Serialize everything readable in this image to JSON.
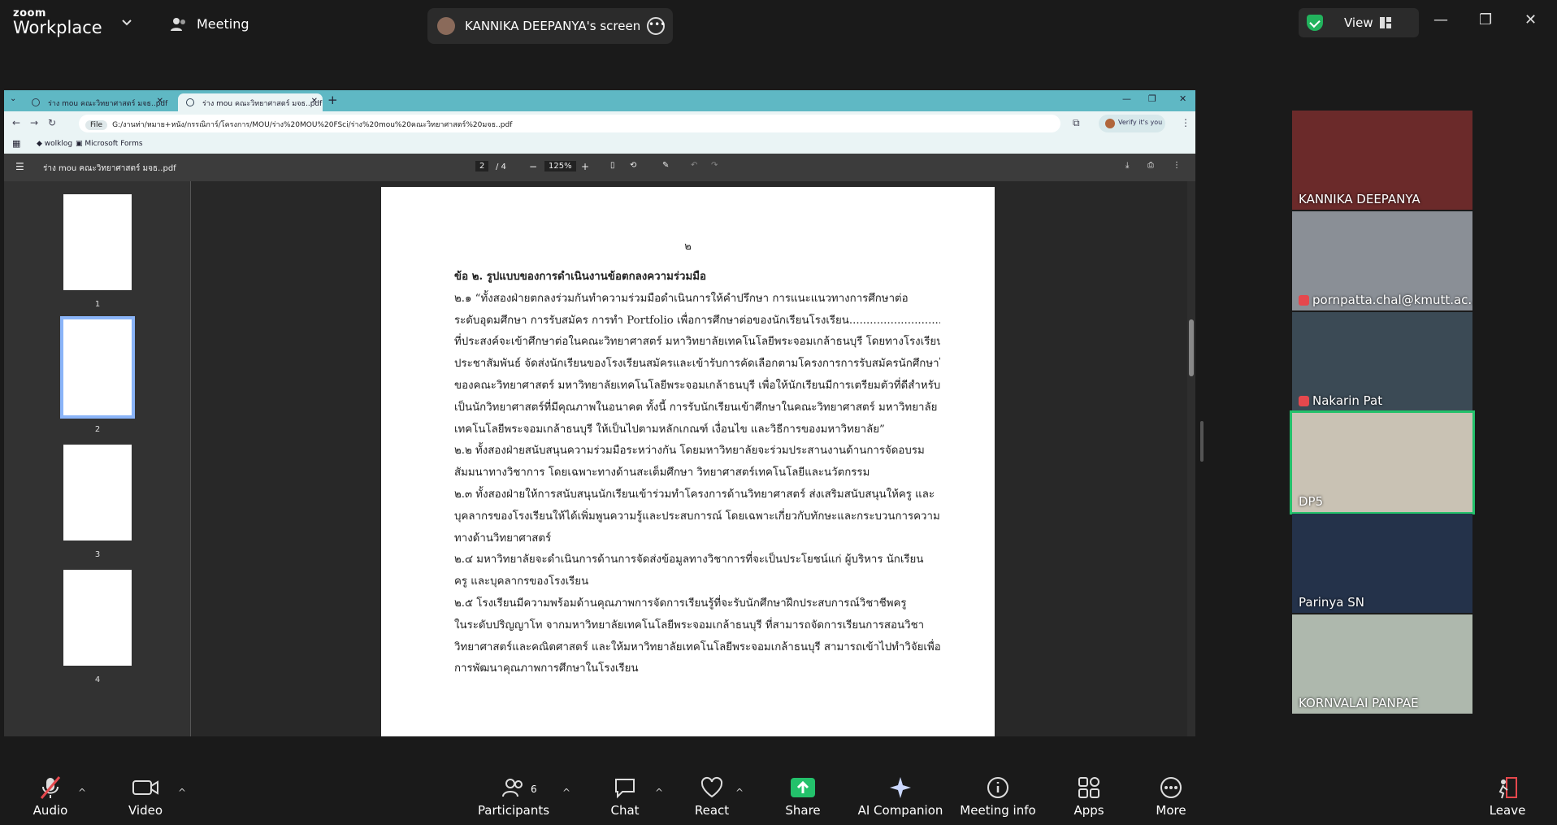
{
  "app": {
    "logo_top": "zoom",
    "logo_bottom": "Workplace",
    "meeting_label": "Meeting",
    "share_label": "KANNIKA DEEPANYA's screen",
    "view_label": "View"
  },
  "browser": {
    "tab1": "ร่าง mou คณะวิทยาศาสตร์ มจธ..pdf",
    "tab2": "ร่าง mou คณะวิทยาศาสตร์ มจธ..pdf",
    "file_badge": "File",
    "url": "G:/งานท่า/หมาย+หนัง/กรรณิการ์/โครงการ/MOU/ร่าง%20MOU%20FSci/ร่าง%20mou%20คณะวิทยาศาสตร์%20มจธ..pdf",
    "verify": "Verify it's you",
    "bookmark1": "wolklog",
    "bookmark2": "Microsoft Forms"
  },
  "pdf": {
    "title": "ร่าง mou คณะวิทยาศาสตร์ มจธ..pdf",
    "page_current": "2",
    "page_total": "/ 4",
    "zoom": "125%",
    "thumb_labels": [
      "1",
      "2",
      "3",
      "4"
    ],
    "page_number": "๒",
    "lines": [
      "ข้อ ๒. รูปแบบของการดำเนินงานข้อตกลงความร่วมมือ",
      "        ๒.๑ “ทั้งสองฝ่ายตกลงร่วมกันทำความร่วมมือดำเนินการให้คำปรึกษา การแนะแนวทางการศึกษาต่อ",
      "ระดับอุดมศึกษา การรับสมัคร การทำ Portfolio เพื่อการศึกษาต่อของนักเรียนโรงเรียน......................................",
      "ที่ประสงค์จะเข้าศึกษาต่อในคณะวิทยาศาสตร์ มหาวิทยาลัยเทคโนโลยีพระจอมเกล้าธนบุรี โดยทางโรงเรียนจะ",
      "ประชาสัมพันธ์ จัดส่งนักเรียนของโรงเรียนสมัครและเข้ารับการคัดเลือกตามโครงการการรับสมัครนักศึกษาใหม่",
      "ของคณะวิทยาศาสตร์ มหาวิทยาลัยเทคโนโลยีพระจอมเกล้าธนบุรี เพื่อให้นักเรียนมีการเตรียมตัวที่ดีสำหรับการ",
      "เป็นนักวิทยาศาสตร์ที่มีคุณภาพในอนาคต ทั้งนี้ การรับนักเรียนเข้าศึกษาในคณะวิทยาศาสตร์ มหาวิทยาลัย",
      "เทคโนโลยีพระจอมเกล้าธนบุรี ให้เป็นไปตามหลักเกณฑ์ เงื่อนไข และวิธีการของมหาวิทยาลัย”",
      "        ๒.๒ ทั้งสองฝ่ายสนับสนุนความร่วมมือระหว่างกัน โดยมหาวิทยาลัยจะร่วมประสานงานด้านการจัดอบรม",
      "สัมมนาทางวิชาการ โดยเฉพาะทางด้านสะเต็มศึกษา วิทยาศาสตร์เทคโนโลยีและนวัตกรรม",
      "        ๒.๓ ทั้งสองฝ่ายให้การสนับสนุนนักเรียนเข้าร่วมทำโครงการด้านวิทยาศาสตร์ ส่งเสริมสนับสนุนให้ครู และ",
      "บุคลากรของโรงเรียนให้ได้เพิ่มพูนความรู้และประสบการณ์ โดยเฉพาะเกี่ยวกับทักษะและกระบวนการความรู้",
      "ทางด้านวิทยาศาสตร์",
      "        ๒.๔ มหาวิทยาลัยจะดำเนินการด้านการจัดส่งข้อมูลทางวิชาการที่จะเป็นประโยชน์แก่ ผู้บริหาร นักเรียน",
      "ครู และบุคลากรของโรงเรียน",
      "        ๒.๕ โรงเรียนมีความพร้อมด้านคุณภาพการจัดการเรียนรู้ที่จะรับนักศึกษาฝึกประสบการณ์วิชาชีพครู",
      "ในระดับปริญญาโท จากมหาวิทยาลัยเทคโนโลยีพระจอมเกล้าธนบุรี ที่สามารถจัดการเรียนการสอนวิชา",
      "วิทยาศาสตร์และคณิตศาสตร์ และให้มหาวิทยาลัยเทคโนโลยีพระจอมเกล้าธนบุรี สามารถเข้าไปทำวิจัยเพื่อ",
      "การพัฒนาคุณภาพการศึกษาในโรงเรียน"
    ]
  },
  "participants": [
    {
      "name": "KANNIKA DEEPANYA",
      "muted": false,
      "color": "#6b2a2a"
    },
    {
      "name": "pornpatta.chal@kmutt.ac....",
      "muted": true,
      "color": "#8a8f96"
    },
    {
      "name": "Nakarin Pat",
      "muted": true,
      "color": "#3b4a55"
    },
    {
      "name": "DP5",
      "muted": false,
      "color": "#c9c2b4"
    },
    {
      "name": "Parinya SN",
      "muted": false,
      "color": "#24324a"
    },
    {
      "name": "KORNVALAI PANPAE",
      "muted": false,
      "color": "#aeb8ad"
    }
  ],
  "toolbar": {
    "audio": "Audio",
    "video": "Video",
    "participants": "Participants",
    "participants_count": "6",
    "chat": "Chat",
    "react": "React",
    "share": "Share",
    "ai": "AI Companion",
    "info": "Meeting info",
    "apps": "Apps",
    "more": "More",
    "leave": "Leave"
  },
  "colors": {
    "share_green": "#23c16b",
    "active_outline": "#23c16b",
    "mute_red": "#e5484d"
  }
}
